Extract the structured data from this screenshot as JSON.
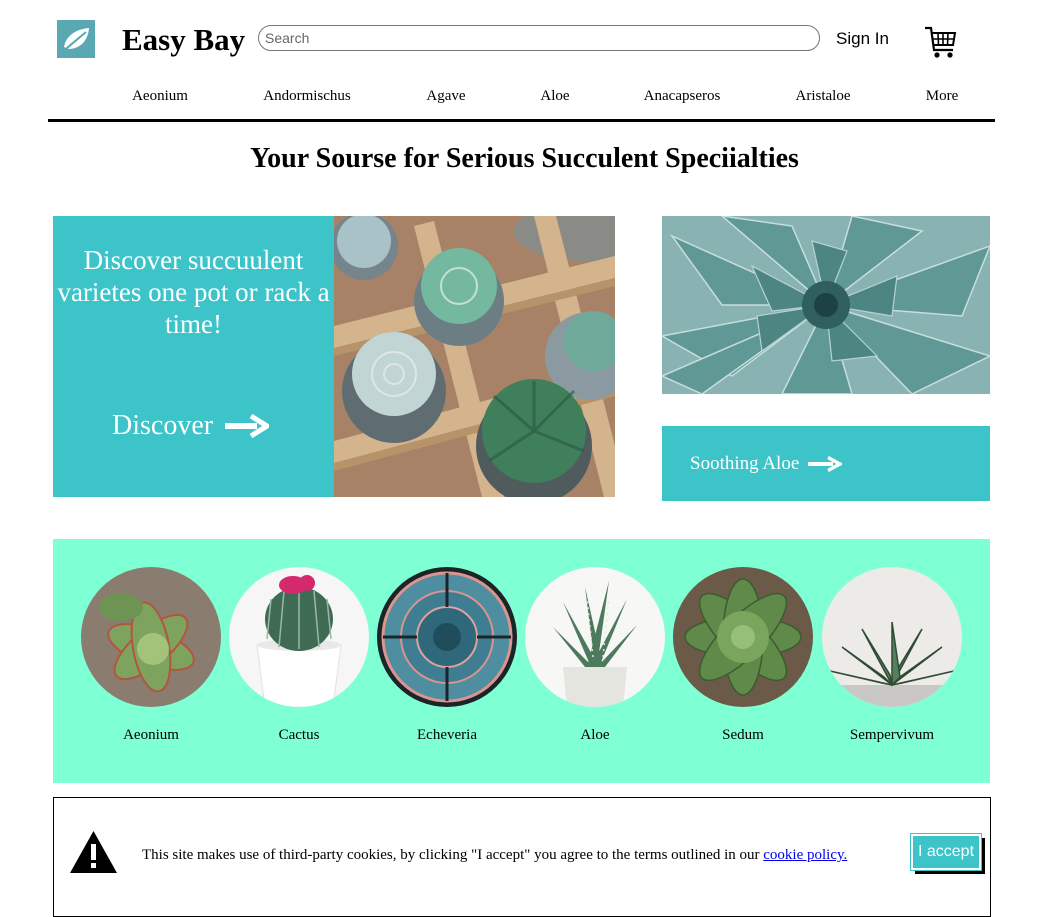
{
  "header": {
    "brand": "Easy Bay",
    "search_placeholder": "Search",
    "sign_in": "Sign In",
    "logo_icon": "leaf-icon",
    "cart_icon": "cart-icon"
  },
  "nav": {
    "items": [
      "Aeonium",
      "Andormischus",
      "Agave",
      "Aloe",
      "Anacapseros",
      "Aristaloe",
      "More"
    ]
  },
  "headline": "Your Sourse for Serious Succulent Speciialties",
  "hero": {
    "text": "Discover succuulent varietes one pot or rack a time!",
    "cta": "Discover"
  },
  "side": {
    "cta": "Soothing Aloe"
  },
  "categories": [
    {
      "label": "Aeonium"
    },
    {
      "label": "Cactus"
    },
    {
      "label": "Echeveria"
    },
    {
      "label": "Aloe"
    },
    {
      "label": "Sedum"
    },
    {
      "label": "Sempervivum"
    }
  ],
  "cookie": {
    "text": "This site makes use of third-party cookies, by clicking \"I accept\" you agree to the terms outlined in our",
    "link": "cookie policy.",
    "accept": "I accept",
    "icon": "warning-icon"
  },
  "colors": {
    "accent": "#3cc4c9",
    "categories_bg": "#7fffd4",
    "link": "#0000ee"
  }
}
